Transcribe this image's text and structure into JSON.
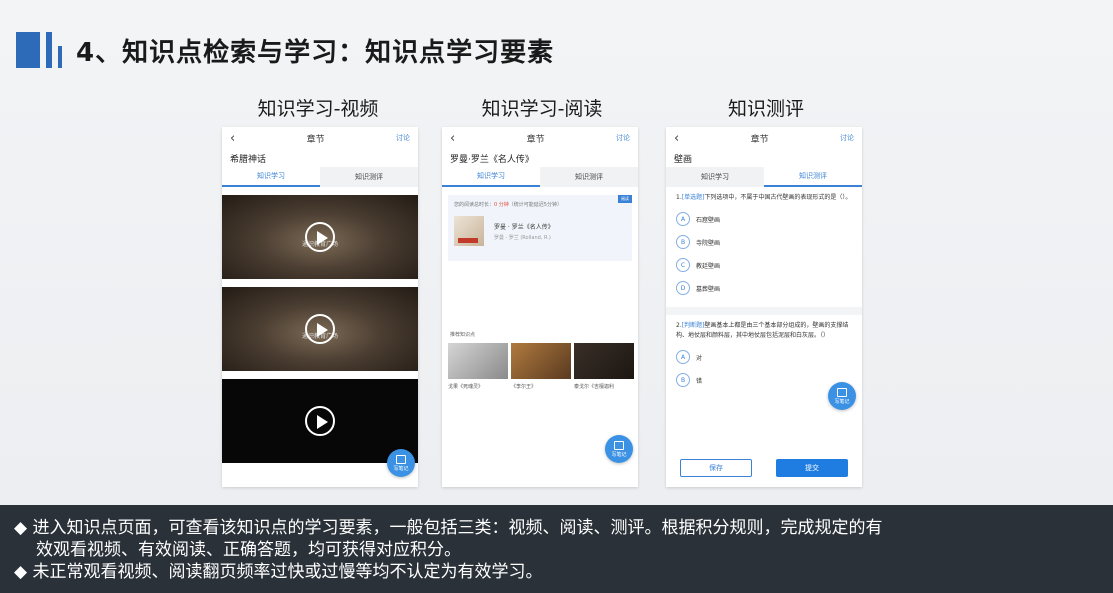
{
  "slide": {
    "title": "4、知识点检索与学习：知识点学习要素",
    "columns": [
      "知识学习-视频",
      "知识学习-阅读",
      "知识测评"
    ]
  },
  "phone_video": {
    "back_icon": "‹",
    "header": "章节",
    "link": "讨论",
    "heading": "希腊神话",
    "tabs": [
      "知识学习",
      "知识测评"
    ],
    "video_captions": [
      "通识教育广场",
      "通识教育广场"
    ],
    "fab_label": "写笔记"
  },
  "phone_read": {
    "back_icon": "‹",
    "header": "章节",
    "link": "讨论",
    "heading": "罗曼·罗兰《名人传》",
    "tabs": [
      "知识学习",
      "知识测评"
    ],
    "badge": "阅读",
    "meta_prefix": "您的阅读总时长：",
    "meta_value": "0 分钟",
    "meta_suffix": "（统计可能延迟5分钟）",
    "book_title": "罗曼 · 罗兰《名人传》",
    "book_sub": "罗曼 · 罗兰 (Rolland, R.)",
    "rec_label": "推荐知识点",
    "rec_captions": [
      "戈果《死魂灵》",
      "《李尔王》",
      "泰戈尔《吉檀迦利"
    ],
    "fab_label": "写笔记"
  },
  "phone_quiz": {
    "back_icon": "‹",
    "header": "章节",
    "link": "讨论",
    "heading": "壁画",
    "tabs": [
      "知识学习",
      "知识测评"
    ],
    "q1_tag": "[单选题]",
    "q1_text": "下列选项中，不属于中国古代壁画的表现形式的是（）。",
    "q1_options": [
      {
        "key": "A",
        "text": "石窟壁画"
      },
      {
        "key": "B",
        "text": "寺院壁画"
      },
      {
        "key": "C",
        "text": "教廷壁画"
      },
      {
        "key": "D",
        "text": "墓葬壁画"
      }
    ],
    "q2_tag": "[判断题]",
    "q2_text": "壁画基本上都是由三个基本部分组成的，壁画的支撑结构、地仗层和颜料层，其中地仗层包括泥层和白灰层。（）",
    "q2_options": [
      {
        "key": "A",
        "text": "对"
      },
      {
        "key": "B",
        "text": "错"
      }
    ],
    "save": "保存",
    "submit": "提交",
    "fab_label": "写笔记"
  },
  "bullets": {
    "b1_line1": "◆ 进入知识点页面，可查看该知识点的学习要素，一般包括三类：视频、阅读、测评。根据积分规则，完成规定的有",
    "b1_line2": "效观看视频、有效阅读、正确答题，均可获得对应积分。",
    "b2": "◆ 未正常观看视频、阅读翻页频率过快或过慢等均不认定为有效学习。"
  }
}
